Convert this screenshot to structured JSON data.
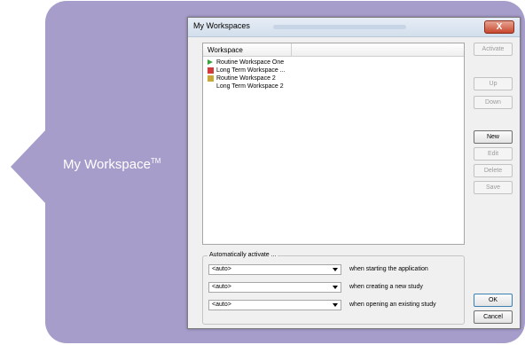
{
  "callout": {
    "label": "My Workspace",
    "trademark": "TM",
    "color": "#a69dcb"
  },
  "dialog": {
    "title": "My Workspaces",
    "close_icon": "close-icon",
    "close_glyph": "X",
    "list": {
      "column_header": "Workspace",
      "items": [
        {
          "label": "Routine Workspace One",
          "icon": "play-icon"
        },
        {
          "label": "Long Term Workspace ...",
          "icon": "red-workspace-icon"
        },
        {
          "label": "Routine Workspace 2",
          "icon": "yellow-workspace-icon"
        },
        {
          "label": "Long Term Workspace 2",
          "icon": ""
        }
      ]
    },
    "buttons": {
      "activate": "Activate",
      "up": "Up",
      "down": "Down",
      "new": "New",
      "edit": "Edit",
      "delete": "Delete",
      "save": "Save",
      "ok": "OK",
      "cancel": "Cancel"
    },
    "auto_activate": {
      "legend": "Automatically activate ...",
      "rows": [
        {
          "value": "<auto>",
          "description": "when starting the application"
        },
        {
          "value": "<auto>",
          "description": "when creating a new study"
        },
        {
          "value": "<auto>",
          "description": "when opening an existing study"
        }
      ]
    }
  }
}
